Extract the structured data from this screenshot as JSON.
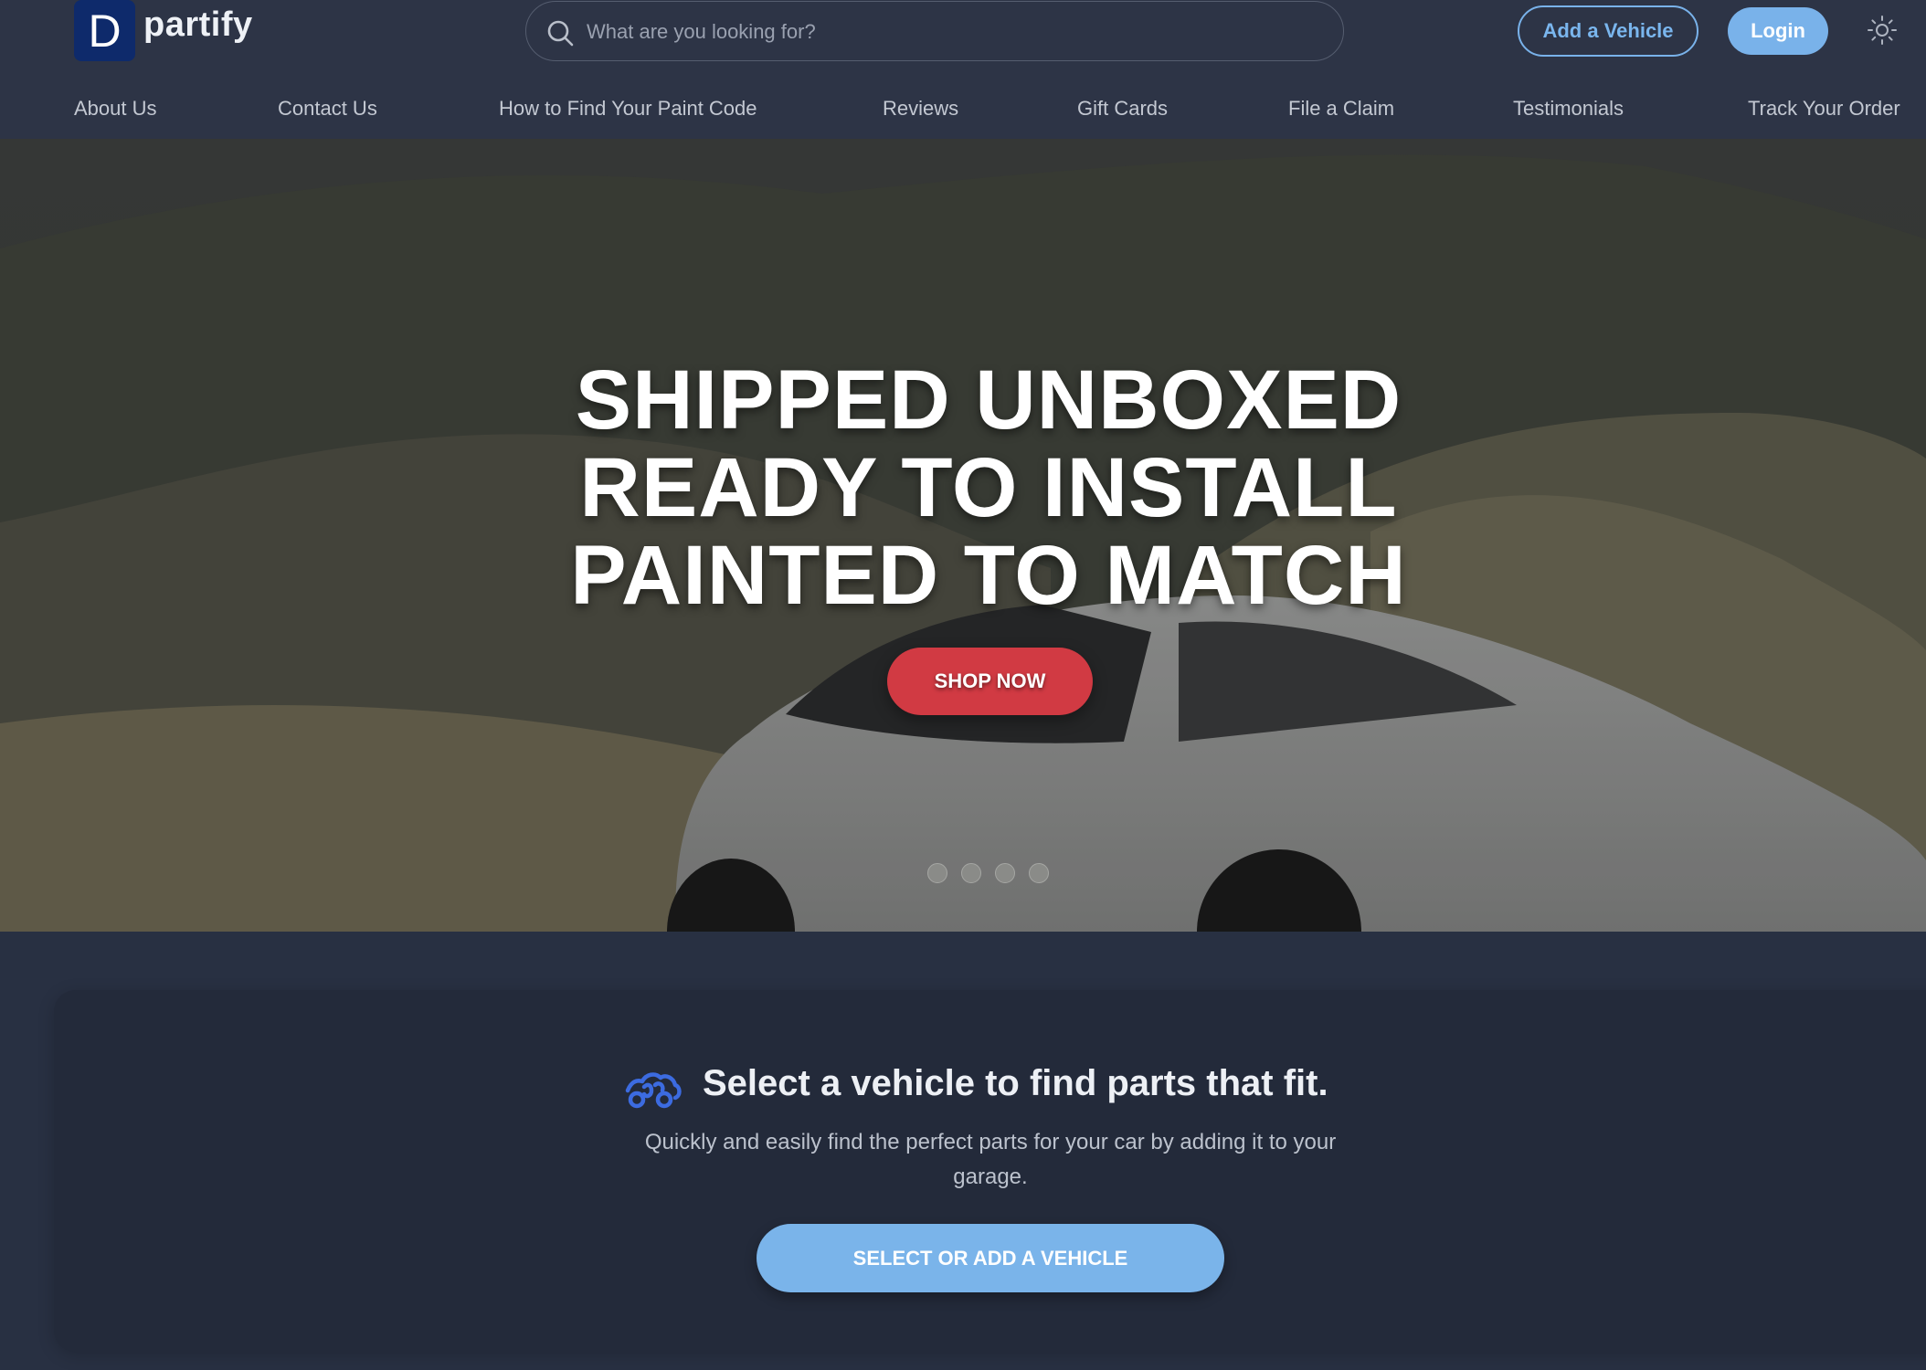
{
  "brand": {
    "logo_letter": "D",
    "name": "partify"
  },
  "search": {
    "placeholder": "What are you looking for?"
  },
  "header": {
    "add_vehicle_label": "Add a Vehicle",
    "login_label": "Login"
  },
  "nav": {
    "items": [
      {
        "label": "About Us"
      },
      {
        "label": "Contact Us"
      },
      {
        "label": "How to Find Your Paint Code"
      },
      {
        "label": "Reviews"
      },
      {
        "label": "Gift Cards"
      },
      {
        "label": "File a Claim"
      },
      {
        "label": "Testimonials"
      },
      {
        "label": "Track Your Order"
      }
    ]
  },
  "hero": {
    "lines": [
      "SHIPPED UNBOXED",
      "READY TO INSTALL",
      "PAINTED TO MATCH"
    ],
    "cta_label": "SHOP NOW",
    "slides_count": 4
  },
  "vehicle_card": {
    "title": "Select a vehicle to find parts that fit.",
    "subtitle": "Quickly and easily find the perfect parts for your car by adding it to your garage.",
    "button_label": "SELECT OR ADD A VEHICLE"
  },
  "colors": {
    "header_bg": "#2d3446",
    "page_bg": "#283042",
    "accent_blue": "#79b2ea",
    "cta_red": "#d13a43",
    "logo_bg": "#0e2a6b"
  },
  "icons": {
    "search": "search-icon",
    "theme": "sun-icon",
    "vehicle": "car-icon"
  }
}
